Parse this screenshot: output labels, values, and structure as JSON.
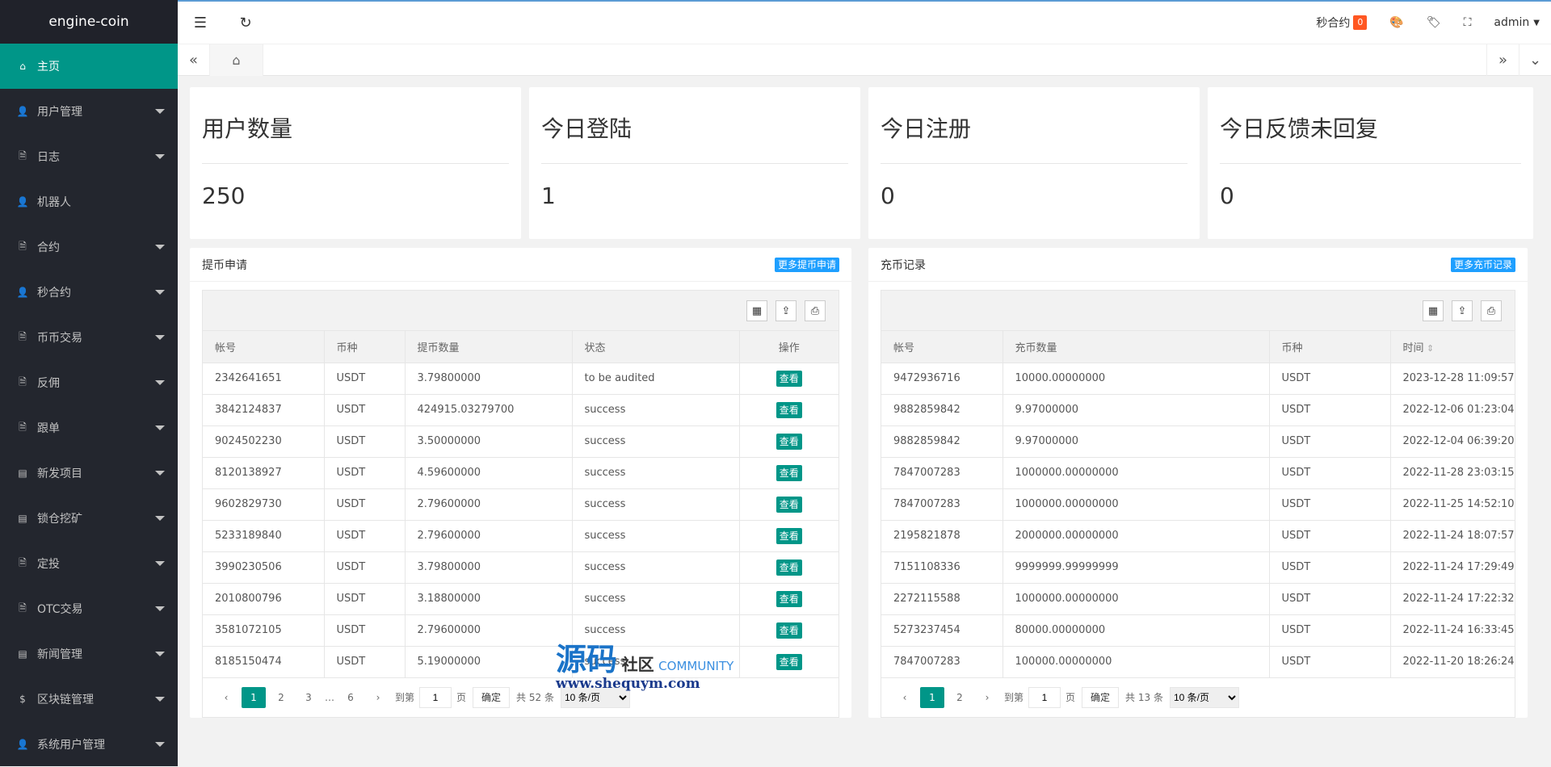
{
  "app": {
    "title": "engine-coin"
  },
  "sidebar": {
    "items": [
      {
        "label": "主页",
        "icon": "home-icon",
        "glyph": "⌂",
        "active": true,
        "caret": false
      },
      {
        "label": "用户管理",
        "icon": "user-icon",
        "glyph": "👤",
        "caret": true
      },
      {
        "label": "日志",
        "icon": "file-icon",
        "glyph": "🗎",
        "caret": true
      },
      {
        "label": "机器人",
        "icon": "user-icon",
        "glyph": "👤",
        "caret": false
      },
      {
        "label": "合约",
        "icon": "file-icon",
        "glyph": "🗎",
        "caret": true
      },
      {
        "label": "秒合约",
        "icon": "user-icon",
        "glyph": "👤",
        "caret": true
      },
      {
        "label": "币币交易",
        "icon": "file-icon",
        "glyph": "🗎",
        "caret": true
      },
      {
        "label": "反佣",
        "icon": "file-icon",
        "glyph": "🗎",
        "caret": true
      },
      {
        "label": "跟单",
        "icon": "file-icon",
        "glyph": "🗎",
        "caret": true
      },
      {
        "label": "新发项目",
        "icon": "doc-icon",
        "glyph": "▤",
        "caret": true
      },
      {
        "label": "锁仓挖矿",
        "icon": "doc-icon",
        "glyph": "▤",
        "caret": true
      },
      {
        "label": "定投",
        "icon": "file-icon",
        "glyph": "🗎",
        "caret": true
      },
      {
        "label": "OTC交易",
        "icon": "file-icon",
        "glyph": "🗎",
        "caret": true
      },
      {
        "label": "新闻管理",
        "icon": "doc-icon",
        "glyph": "▤",
        "caret": true
      },
      {
        "label": "区块链管理",
        "icon": "dollar-icon",
        "glyph": "$",
        "caret": true
      },
      {
        "label": "系统用户管理",
        "icon": "user-icon",
        "glyph": "👤",
        "caret": true
      }
    ]
  },
  "topbar": {
    "seconds_contract": "秒合约",
    "badge": "0",
    "user": "admin"
  },
  "stats": [
    {
      "title": "用户数量",
      "value": "250"
    },
    {
      "title": "今日登陆",
      "value": "1"
    },
    {
      "title": "今日注册",
      "value": "0"
    },
    {
      "title": "今日反馈未回复",
      "value": "0"
    }
  ],
  "withdraw": {
    "title": "提币申请",
    "more": "更多提币申请",
    "columns": [
      "帐号",
      "币种",
      "提币数量",
      "状态",
      "操作"
    ],
    "view_label": "查看",
    "rows": [
      [
        "2342641651",
        "USDT",
        "3.79800000",
        "to be audited"
      ],
      [
        "3842124837",
        "USDT",
        "424915.03279700",
        "success"
      ],
      [
        "9024502230",
        "USDT",
        "3.50000000",
        "success"
      ],
      [
        "8120138927",
        "USDT",
        "4.59600000",
        "success"
      ],
      [
        "9602829730",
        "USDT",
        "2.79600000",
        "success"
      ],
      [
        "5233189840",
        "USDT",
        "2.79600000",
        "success"
      ],
      [
        "3990230506",
        "USDT",
        "3.79800000",
        "success"
      ],
      [
        "2010800796",
        "USDT",
        "3.18800000",
        "success"
      ],
      [
        "3581072105",
        "USDT",
        "2.79600000",
        "success"
      ],
      [
        "8185150474",
        "USDT",
        "5.19000000",
        "success"
      ]
    ],
    "pager": {
      "pages": [
        "1",
        "2",
        "3",
        "…",
        "6"
      ],
      "goto": "到第",
      "page_val": "1",
      "page_unit": "页",
      "ok": "确定",
      "total": "共 52 条",
      "size": "10 条/页"
    }
  },
  "deposit": {
    "title": "充币记录",
    "more": "更多充币记录",
    "columns": [
      "帐号",
      "充币数量",
      "币种",
      "时间"
    ],
    "rows": [
      [
        "9472936716",
        "10000.00000000",
        "USDT",
        "2023-12-28 11:09:57"
      ],
      [
        "9882859842",
        "9.97000000",
        "USDT",
        "2022-12-06 01:23:04"
      ],
      [
        "9882859842",
        "9.97000000",
        "USDT",
        "2022-12-04 06:39:20"
      ],
      [
        "7847007283",
        "1000000.00000000",
        "USDT",
        "2022-11-28 23:03:15"
      ],
      [
        "7847007283",
        "1000000.00000000",
        "USDT",
        "2022-11-25 14:52:10"
      ],
      [
        "2195821878",
        "2000000.00000000",
        "USDT",
        "2022-11-24 18:07:57"
      ],
      [
        "7151108336",
        "9999999.99999999",
        "USDT",
        "2022-11-24 17:29:49"
      ],
      [
        "2272115588",
        "1000000.00000000",
        "USDT",
        "2022-11-24 17:22:32"
      ],
      [
        "5273237454",
        "80000.00000000",
        "USDT",
        "2022-11-24 16:33:45"
      ],
      [
        "7847007283",
        "100000.00000000",
        "USDT",
        "2022-11-20 18:26:24"
      ]
    ],
    "pager": {
      "pages": [
        "1",
        "2"
      ],
      "goto": "到第",
      "page_val": "1",
      "page_unit": "页",
      "ok": "确定",
      "total": "共 13 条",
      "size": "10 条/页"
    }
  },
  "watermark": {
    "line1": "源码",
    "line1b": "社区",
    "line1c": "COMMUNITY",
    "line2": "www.shequym.com"
  }
}
